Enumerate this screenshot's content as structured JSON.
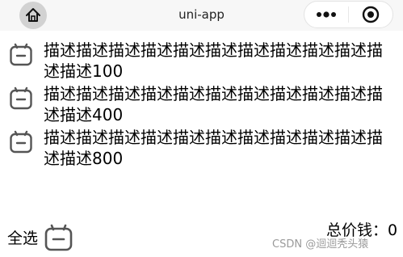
{
  "navbar": {
    "title": "uni-app",
    "home_icon": "home-icon",
    "menu_icon": "more-dots-icon",
    "close_icon": "target-circle-icon"
  },
  "items": [
    {
      "label": "描述描述描述描述描述描述描述描述描述描述描述描述100",
      "checkbox_icon": "checkbox-icon"
    },
    {
      "label": "描述描述描述描述描述描述描述描述描述描述描述描述400",
      "checkbox_icon": "checkbox-icon"
    },
    {
      "label": "描述描述描述描述描述描述描述描述描述描述描述描述800",
      "checkbox_icon": "checkbox-icon"
    }
  ],
  "footer": {
    "select_all_label": "全选",
    "total_label": "总价钱：0"
  },
  "watermark": "CSDN @迴迴秃头猿"
}
